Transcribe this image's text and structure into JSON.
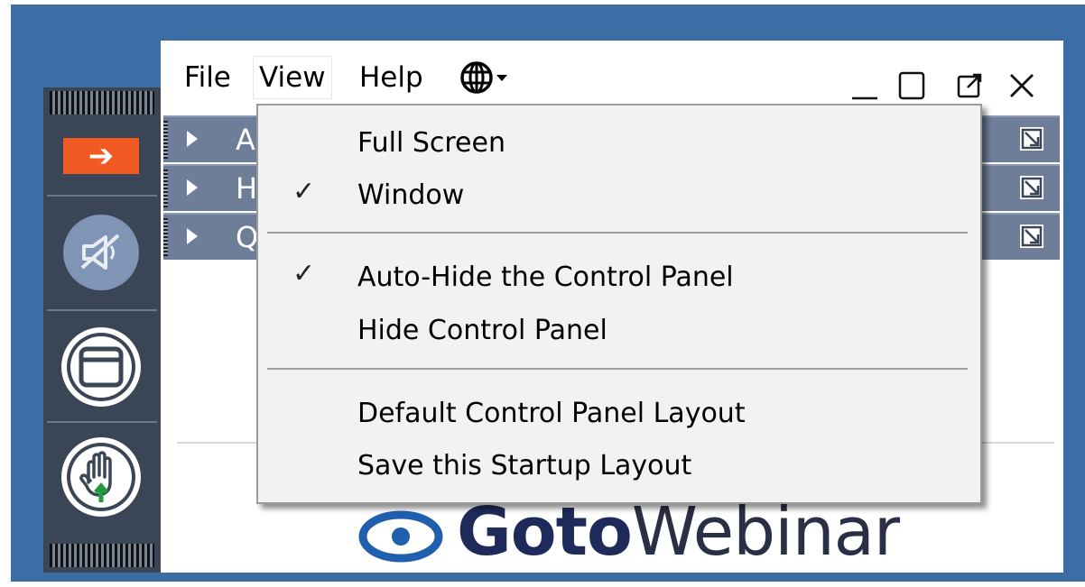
{
  "menubar": {
    "file": "File",
    "view": "View",
    "help": "Help"
  },
  "window_controls": [
    "minimize-icon",
    "maximize-icon",
    "popout-icon",
    "close-icon"
  ],
  "panes": [
    {
      "letter": "A"
    },
    {
      "letter": "H"
    },
    {
      "letter": "Q"
    }
  ],
  "view_menu": {
    "items": [
      {
        "label": "Full Screen",
        "checked": false
      },
      {
        "label": "Window",
        "checked": true
      },
      {
        "label": "Auto-Hide the Control Panel",
        "checked": true
      },
      {
        "label": "Hide Control Panel",
        "checked": false
      },
      {
        "label": "Default Control Panel Layout",
        "checked": false
      },
      {
        "label": "Save this Startup Layout",
        "checked": false
      }
    ],
    "check_glyph": "✓"
  },
  "grab_tab": {
    "arrow": "➔"
  },
  "logo": {
    "bold": "Goto",
    "light": "Webinar"
  },
  "colors": {
    "desktop": "#3c6ea5",
    "grab_tab": "#3a4556",
    "arrow_button": "#f15a22",
    "pane_row": "#6e7e99",
    "menu_bg": "#f2f2f2",
    "hand_arrow": "#1f9b3c"
  }
}
